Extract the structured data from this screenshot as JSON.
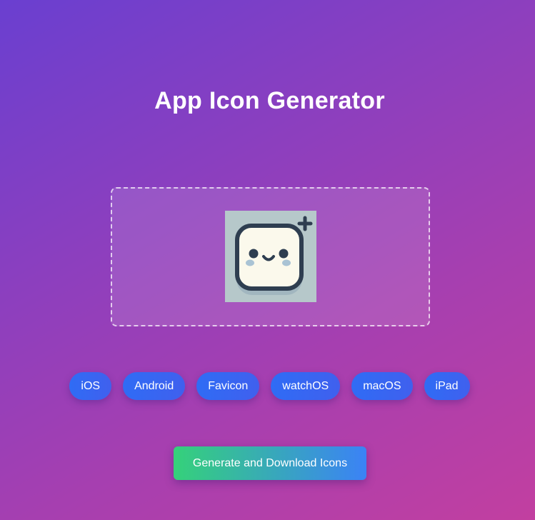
{
  "header": {
    "title": "App Icon Generator"
  },
  "upload": {
    "preview_icon": "smiling-square-app-icon-with-plus"
  },
  "platforms": [
    {
      "label": "iOS"
    },
    {
      "label": "Android"
    },
    {
      "label": "Favicon"
    },
    {
      "label": "watchOS"
    },
    {
      "label": "macOS"
    },
    {
      "label": "iPad"
    }
  ],
  "actions": {
    "generate_label": "Generate and Download Icons"
  },
  "colors": {
    "background_start": "#6a3fd0",
    "background_end": "#c23fa0",
    "chip": "#2f6cf5",
    "button_start": "#35d17a",
    "button_end": "#3b82f6"
  }
}
